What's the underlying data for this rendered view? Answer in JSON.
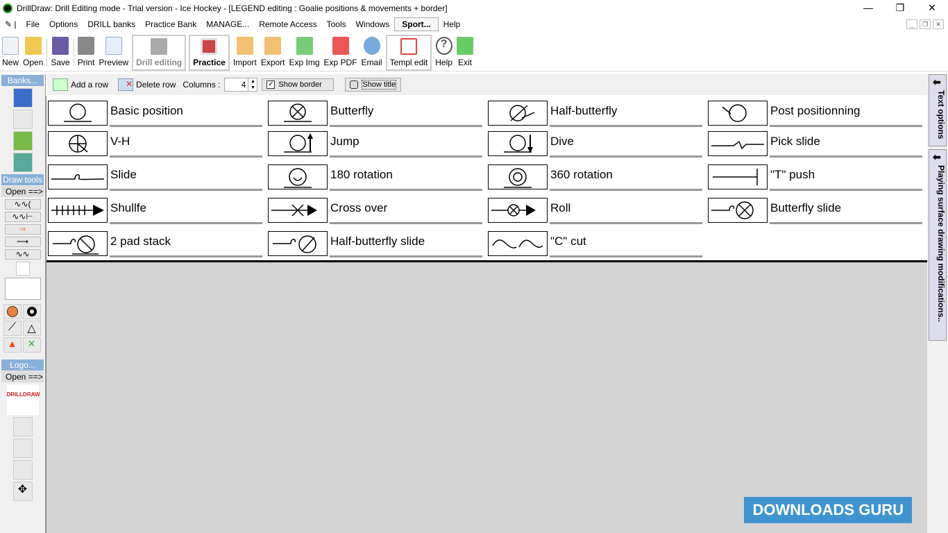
{
  "title": "DrillDraw:  Drill Editing mode - Trial version - Ice Hockey - [LEGEND editing :  Goalie positions & movements + border]",
  "menu": [
    "File",
    "Options",
    "DRILL banks",
    "Practice Bank",
    "MANAGE...",
    "Remote Access",
    "Tools",
    "Windows",
    "Sport...",
    "Help"
  ],
  "toolbar": {
    "new": "New",
    "open": "Open",
    "save": "Save",
    "print": "Print",
    "preview": "Preview",
    "drill_editing": "Drill editing",
    "practice": "Practice",
    "import": "Import",
    "export": "Export",
    "exp_img": "Exp Img",
    "exp_pdf": "Exp PDF",
    "email": "Email",
    "templ_edit": "Templ edit",
    "help": "Help",
    "exit": "Exit"
  },
  "sub": {
    "add_row": "Add a row",
    "delete_row": "Delete row",
    "columns_label": "Columns :",
    "columns_value": "4",
    "show_border": "Show border",
    "show_border_checked": true,
    "show_title": "Show title",
    "show_title_checked": false
  },
  "left": {
    "banks": "Banks...",
    "draw_tools": "Draw tools",
    "open1": "Open ==>",
    "logo": "Logo...",
    "open2": "Open ==>",
    "logo_text": "DRILLDRAW"
  },
  "right": {
    "text_options": "Text options",
    "playing_surface": "Playing surface drawing modifications.."
  },
  "legend": [
    {
      "label": "Basic position",
      "icon": "basic-position"
    },
    {
      "label": "Butterfly",
      "icon": "butterfly"
    },
    {
      "label": "Half-butterfly",
      "icon": "half-butterfly"
    },
    {
      "label": "Post positionning",
      "icon": "post-positioning"
    },
    {
      "label": " V-H",
      "icon": "v-h"
    },
    {
      "label": "Jump",
      "icon": "jump"
    },
    {
      "label": "Dive",
      "icon": "dive"
    },
    {
      "label": "Pick slide",
      "icon": "pick-slide"
    },
    {
      "label": "Slide",
      "icon": "slide"
    },
    {
      "label": "180 rotation",
      "icon": "rotation-180"
    },
    {
      "label": "360 rotation",
      "icon": "rotation-360"
    },
    {
      "label": " \"T\" push",
      "icon": "t-push"
    },
    {
      "label": "Shullfe",
      "icon": "shuffle"
    },
    {
      "label": "Cross over",
      "icon": "cross-over"
    },
    {
      "label": "Roll",
      "icon": "roll"
    },
    {
      "label": "Butterfly slide",
      "icon": "butterfly-slide"
    },
    {
      "label": "2 pad stack",
      "icon": "two-pad-stack"
    },
    {
      "label": "Half-butterfly slide",
      "icon": "half-butterfly-slide"
    },
    {
      "label": " \"C\" cut",
      "icon": "c-cut"
    }
  ],
  "watermark": "DOWNLOADS GURU"
}
